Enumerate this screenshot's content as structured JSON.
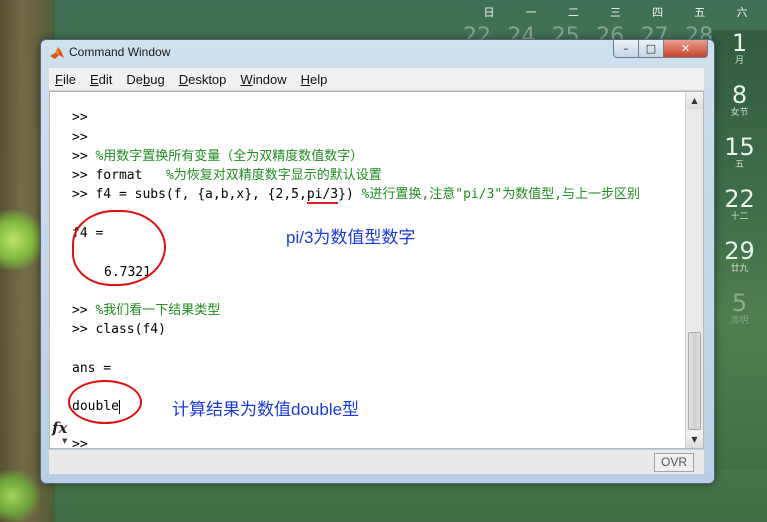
{
  "desktop": {
    "weekdays": [
      "日",
      "一",
      "二",
      "三",
      "四",
      "五",
      "六"
    ],
    "big_dates": [
      "22",
      "24",
      "25",
      "26",
      "27",
      "28"
    ],
    "side_dates": [
      {
        "n": "1",
        "l": "月"
      },
      {
        "n": "8",
        "l": "女节"
      },
      {
        "n": "15",
        "l": "五"
      },
      {
        "n": "22",
        "l": "十二"
      },
      {
        "n": "29",
        "l": "廿九"
      },
      {
        "n": "5",
        "l": "清明"
      }
    ]
  },
  "window": {
    "title": "Command Window",
    "menu": [
      "File",
      "Edit",
      "Debug",
      "Desktop",
      "Window",
      "Help"
    ],
    "menu_mnemonics": [
      "F",
      "E",
      "b",
      "D",
      "W",
      "H"
    ]
  },
  "console": {
    "lines": [
      {
        "prompt": ">>",
        "code": "",
        "comment": ""
      },
      {
        "prompt": ">>",
        "code": "",
        "comment": ""
      },
      {
        "prompt": ">>",
        "code": "",
        "comment": "%用数字置换所有变量（全为双精度数值数字）"
      },
      {
        "prompt": ">>",
        "code": "format   ",
        "comment": "%为恢复对双精度数字显示的默认设置"
      },
      {
        "prompt": ">>",
        "code_a": "f4 = subs(f, {a,b,x}, {2,5,",
        "code_u": "pi/3",
        "code_b": "}) ",
        "comment": "%进行置换,注意\"pi/3\"为数值型,与上一步区别"
      }
    ],
    "result1_name": "f4 =",
    "result1_value": "6.7321",
    "lines2": [
      {
        "prompt": ">>",
        "comment": "%我们看一下结果类型"
      },
      {
        "prompt": ">>",
        "code": "class(f4)"
      }
    ],
    "result2_name": "ans =",
    "result2_value": "double",
    "current_prompt": ">>",
    "fx_label": "fx"
  },
  "annotations": {
    "note1": "pi/3为数值型数字",
    "note2": "计算结果为数值double型",
    "color": "#1a3bd6",
    "circle_color": "#e01010"
  },
  "status": {
    "ovr": "OVR"
  }
}
